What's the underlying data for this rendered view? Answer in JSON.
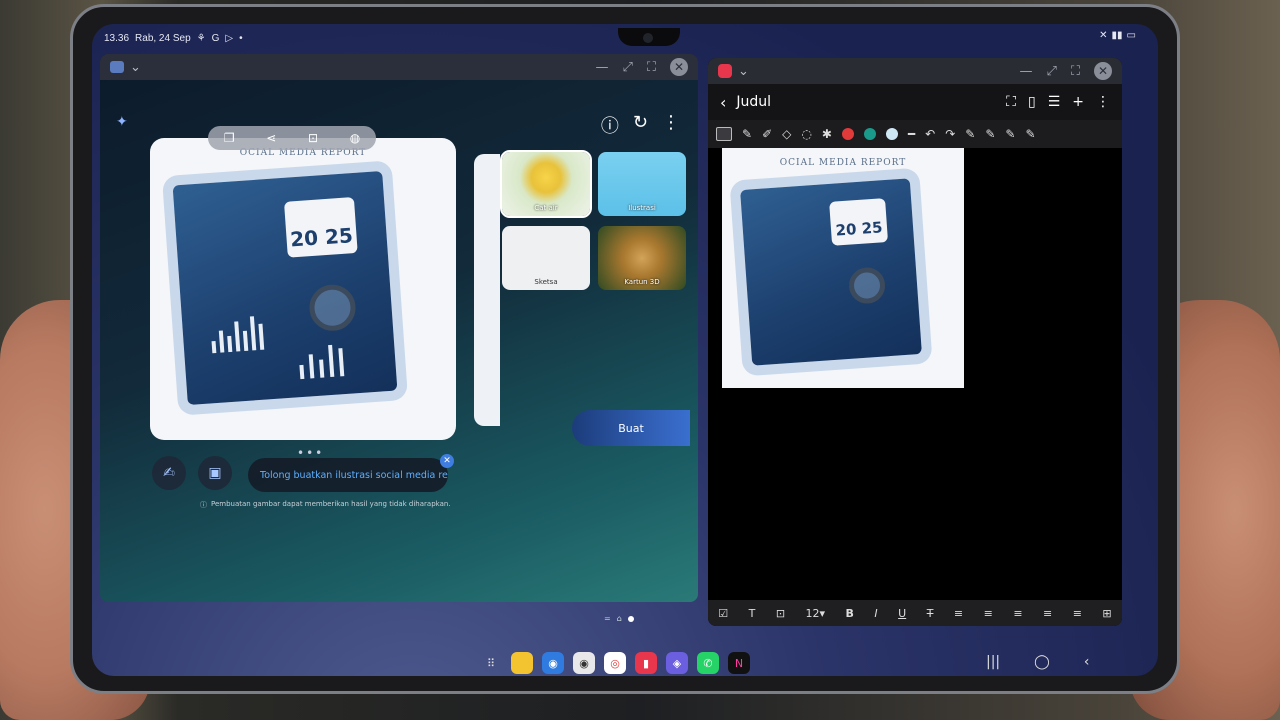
{
  "status_bar": {
    "time": "13.36",
    "date": "Rab, 24 Sep",
    "icons": [
      "vpn-icon",
      "google-icon",
      "play-icon",
      "dot"
    ]
  },
  "left_window": {
    "title_icons": [
      "app-icon",
      "chevron-down-icon"
    ],
    "controls": [
      "minimize",
      "expand",
      "fullscreen",
      "close"
    ],
    "top_actions": [
      "alert-icon",
      "refresh-icon",
      "more-icon"
    ],
    "preview": {
      "title": "OCIAL MEDIA REPORT",
      "calendar_year": "20 25",
      "toolbar_icons": [
        "copy-icon",
        "share-icon",
        "save-icon",
        "palette-icon"
      ]
    },
    "styles": [
      {
        "label": "Cat air",
        "selected": true
      },
      {
        "label": "Ilustrasi",
        "selected": false
      },
      {
        "label": "Sketsa",
        "selected": false
      },
      {
        "label": "Kartun 3D",
        "selected": false
      }
    ],
    "create_button": "Buat",
    "prompt_text": "Tolong buatkan ilustrasi social media repor...",
    "disclaimer": "Pembuatan gambar dapat memberikan hasil yang tidak diharapkan.",
    "carousel_dots": "•••"
  },
  "right_window": {
    "note_title": "Judul",
    "image_title": "OCIAL MEDIA REPORT",
    "calendar_year": "20 25",
    "pen_colors": [
      "#e03a3a",
      "#1a9a8a",
      "#cfe8f6"
    ],
    "font_size": "12▾",
    "format_labels": [
      "☑",
      "T",
      "⊡",
      "12▾",
      "B",
      "I",
      "U",
      "T",
      "≡",
      "≡",
      "≡",
      "≡",
      "≡",
      "⊞"
    ]
  },
  "taskbar": {
    "apps": [
      "apps-grid",
      "files",
      "messages",
      "camera",
      "chrome",
      "notes",
      "browser",
      "whatsapp",
      "n-app"
    ]
  },
  "colors": {
    "accent": "#3a6fcf",
    "notes_red": "#e8364d"
  }
}
